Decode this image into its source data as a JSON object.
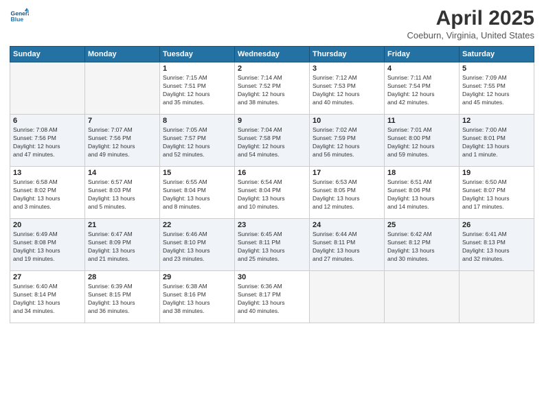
{
  "header": {
    "logo_line1": "General",
    "logo_line2": "Blue",
    "month": "April 2025",
    "location": "Coeburn, Virginia, United States"
  },
  "weekdays": [
    "Sunday",
    "Monday",
    "Tuesday",
    "Wednesday",
    "Thursday",
    "Friday",
    "Saturday"
  ],
  "weeks": [
    [
      {
        "day": "",
        "info": ""
      },
      {
        "day": "",
        "info": ""
      },
      {
        "day": "1",
        "info": "Sunrise: 7:15 AM\nSunset: 7:51 PM\nDaylight: 12 hours\nand 35 minutes."
      },
      {
        "day": "2",
        "info": "Sunrise: 7:14 AM\nSunset: 7:52 PM\nDaylight: 12 hours\nand 38 minutes."
      },
      {
        "day": "3",
        "info": "Sunrise: 7:12 AM\nSunset: 7:53 PM\nDaylight: 12 hours\nand 40 minutes."
      },
      {
        "day": "4",
        "info": "Sunrise: 7:11 AM\nSunset: 7:54 PM\nDaylight: 12 hours\nand 42 minutes."
      },
      {
        "day": "5",
        "info": "Sunrise: 7:09 AM\nSunset: 7:55 PM\nDaylight: 12 hours\nand 45 minutes."
      }
    ],
    [
      {
        "day": "6",
        "info": "Sunrise: 7:08 AM\nSunset: 7:56 PM\nDaylight: 12 hours\nand 47 minutes."
      },
      {
        "day": "7",
        "info": "Sunrise: 7:07 AM\nSunset: 7:56 PM\nDaylight: 12 hours\nand 49 minutes."
      },
      {
        "day": "8",
        "info": "Sunrise: 7:05 AM\nSunset: 7:57 PM\nDaylight: 12 hours\nand 52 minutes."
      },
      {
        "day": "9",
        "info": "Sunrise: 7:04 AM\nSunset: 7:58 PM\nDaylight: 12 hours\nand 54 minutes."
      },
      {
        "day": "10",
        "info": "Sunrise: 7:02 AM\nSunset: 7:59 PM\nDaylight: 12 hours\nand 56 minutes."
      },
      {
        "day": "11",
        "info": "Sunrise: 7:01 AM\nSunset: 8:00 PM\nDaylight: 12 hours\nand 59 minutes."
      },
      {
        "day": "12",
        "info": "Sunrise: 7:00 AM\nSunset: 8:01 PM\nDaylight: 13 hours\nand 1 minute."
      }
    ],
    [
      {
        "day": "13",
        "info": "Sunrise: 6:58 AM\nSunset: 8:02 PM\nDaylight: 13 hours\nand 3 minutes."
      },
      {
        "day": "14",
        "info": "Sunrise: 6:57 AM\nSunset: 8:03 PM\nDaylight: 13 hours\nand 5 minutes."
      },
      {
        "day": "15",
        "info": "Sunrise: 6:55 AM\nSunset: 8:04 PM\nDaylight: 13 hours\nand 8 minutes."
      },
      {
        "day": "16",
        "info": "Sunrise: 6:54 AM\nSunset: 8:04 PM\nDaylight: 13 hours\nand 10 minutes."
      },
      {
        "day": "17",
        "info": "Sunrise: 6:53 AM\nSunset: 8:05 PM\nDaylight: 13 hours\nand 12 minutes."
      },
      {
        "day": "18",
        "info": "Sunrise: 6:51 AM\nSunset: 8:06 PM\nDaylight: 13 hours\nand 14 minutes."
      },
      {
        "day": "19",
        "info": "Sunrise: 6:50 AM\nSunset: 8:07 PM\nDaylight: 13 hours\nand 17 minutes."
      }
    ],
    [
      {
        "day": "20",
        "info": "Sunrise: 6:49 AM\nSunset: 8:08 PM\nDaylight: 13 hours\nand 19 minutes."
      },
      {
        "day": "21",
        "info": "Sunrise: 6:47 AM\nSunset: 8:09 PM\nDaylight: 13 hours\nand 21 minutes."
      },
      {
        "day": "22",
        "info": "Sunrise: 6:46 AM\nSunset: 8:10 PM\nDaylight: 13 hours\nand 23 minutes."
      },
      {
        "day": "23",
        "info": "Sunrise: 6:45 AM\nSunset: 8:11 PM\nDaylight: 13 hours\nand 25 minutes."
      },
      {
        "day": "24",
        "info": "Sunrise: 6:44 AM\nSunset: 8:11 PM\nDaylight: 13 hours\nand 27 minutes."
      },
      {
        "day": "25",
        "info": "Sunrise: 6:42 AM\nSunset: 8:12 PM\nDaylight: 13 hours\nand 30 minutes."
      },
      {
        "day": "26",
        "info": "Sunrise: 6:41 AM\nSunset: 8:13 PM\nDaylight: 13 hours\nand 32 minutes."
      }
    ],
    [
      {
        "day": "27",
        "info": "Sunrise: 6:40 AM\nSunset: 8:14 PM\nDaylight: 13 hours\nand 34 minutes."
      },
      {
        "day": "28",
        "info": "Sunrise: 6:39 AM\nSunset: 8:15 PM\nDaylight: 13 hours\nand 36 minutes."
      },
      {
        "day": "29",
        "info": "Sunrise: 6:38 AM\nSunset: 8:16 PM\nDaylight: 13 hours\nand 38 minutes."
      },
      {
        "day": "30",
        "info": "Sunrise: 6:36 AM\nSunset: 8:17 PM\nDaylight: 13 hours\nand 40 minutes."
      },
      {
        "day": "",
        "info": ""
      },
      {
        "day": "",
        "info": ""
      },
      {
        "day": "",
        "info": ""
      }
    ]
  ]
}
